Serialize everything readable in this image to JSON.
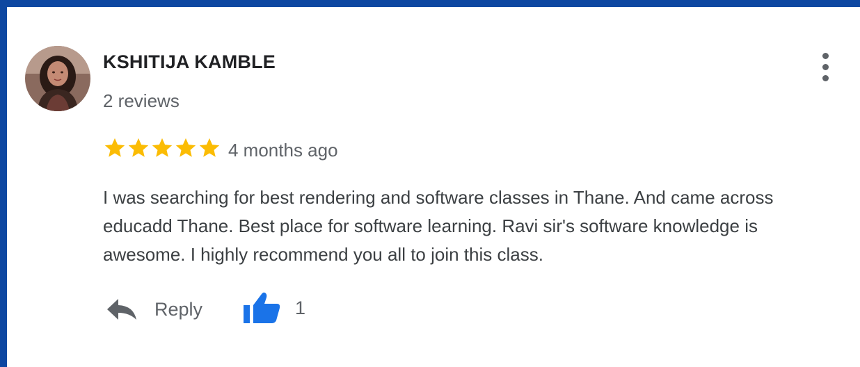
{
  "review": {
    "author_name": "KSHITIJA KAMBLE",
    "review_count": "2 reviews",
    "rating": 5,
    "rating_max": 5,
    "time_ago": "4 months ago",
    "text": "I was searching for best rendering and software classes in Thane. And came across educadd Thane. Best place for software learning. Ravi sir's software knowledge is awesome. I highly recommend you all to join this class.",
    "reply_label": "Reply",
    "like_count": "1"
  },
  "icons": {
    "avatar": "user-photo",
    "more": "more-vert-icon",
    "star": "star-icon",
    "reply": "reply-arrow-icon",
    "like": "thumbs-up-icon"
  },
  "colors": {
    "frame": "#0d47a1",
    "star": "#fbbc04",
    "like": "#1a73e8",
    "name": "#202124",
    "secondary": "#5f6368",
    "body_text": "#3c4043"
  }
}
